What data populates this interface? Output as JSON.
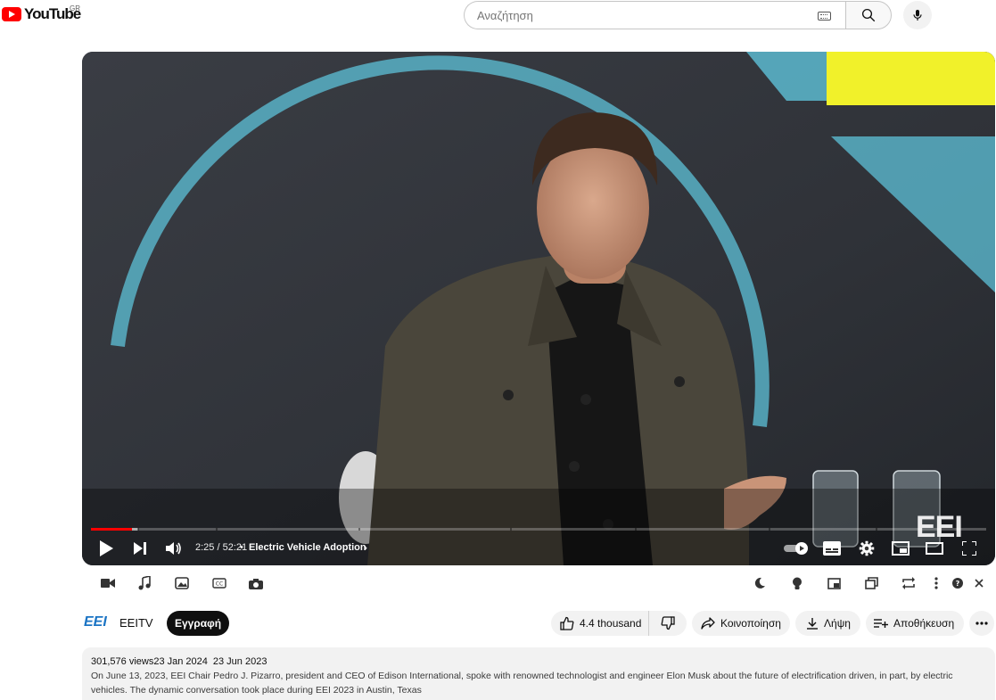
{
  "masthead": {
    "logo_text": "YouTube",
    "country_code": "GR",
    "search_placeholder": "Αναζήτηση",
    "search_value": ""
  },
  "player": {
    "current_time": "2:25",
    "duration": "52:21",
    "time_display": "2:25 / 52:21",
    "chapter_title": "Electric Vehicle Adoption",
    "progress_fraction": 0.046,
    "buffered_fraction": 0.053,
    "watermark": "EEI",
    "controls": [
      "play-icon",
      "next-icon",
      "volume-icon",
      "autoplay-toggle",
      "subtitles-icon",
      "settings-icon",
      "miniplayer-icon",
      "theater-icon",
      "fullscreen-icon"
    ]
  },
  "toolbar": {
    "left_tools": [
      "video-camera-icon",
      "music-note-icon",
      "image-icon",
      "closed-captions-icon",
      "camera-icon"
    ],
    "right_tools": [
      "moon-icon",
      "lightbulb-icon",
      "picture-in-picture-icon",
      "stack-icon",
      "loop-icon",
      "more-vertical-icon",
      "help-icon",
      "close-icon"
    ]
  },
  "channel": {
    "logo_text": "EEI",
    "name": "EEITV",
    "subscribe_label": "Εγγραφή"
  },
  "actions": {
    "like_count": "4.4 thousand",
    "share_label": "Κοινοποίηση",
    "download_label": "Λήψη",
    "save_label": "Αποθήκευση"
  },
  "description": {
    "views": "301,576 views",
    "date_relative": "23 Jan 2024",
    "date_upload": "23 Jun 2023",
    "text": "On June 13, 2023, EEI Chair Pedro J. Pizarro, president and CEO of Edison International, spoke with renowned technologist and engineer Elon Musk about the future of electrification driven, in part, by electric vehicles. The dynamic conversation took place during EEI 2023 in Austin, Texas"
  },
  "colors": {
    "brand_red": "#ff0000",
    "pill_bg": "#f2f2f2",
    "subscribe_bg": "#0f0f0f",
    "channel_blue": "#1b74c4",
    "stage_accent_cyan": "#5ec2d8",
    "stage_accent_yellow": "#f1f12a"
  }
}
